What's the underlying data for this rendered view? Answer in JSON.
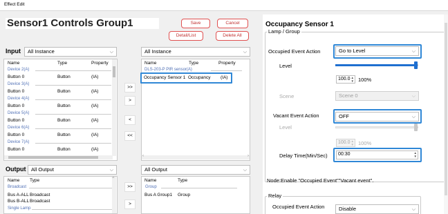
{
  "window": {
    "title": "Effect Edit"
  },
  "header": {
    "name": "Sensor1 Controls Group1",
    "save_label": "Save",
    "cancel_label": "Cancel",
    "detail_label": "Detail/List",
    "delete_all_label": "Delete All"
  },
  "input": {
    "label": "Input",
    "filter_value": "All Instance",
    "columns": [
      "Name",
      "Type",
      "Property"
    ],
    "groups": [
      {
        "group": "Device 2(A)",
        "name": "Button 0",
        "type": "Button",
        "property": "(IA)"
      },
      {
        "group": "Device 3(A)",
        "name": "Button 0",
        "type": "Button",
        "property": "(IA)"
      },
      {
        "group": "Device 4(A)",
        "name": "Button 0",
        "type": "Button",
        "property": "(IA)"
      },
      {
        "group": "Device 5(A)",
        "name": "Button 0",
        "type": "Button",
        "property": "(IA)"
      },
      {
        "group": "Device 6(A)",
        "name": "Button 0",
        "type": "Button",
        "property": "(IA)"
      },
      {
        "group": "Device 7(A)",
        "name": "Button 0",
        "type": "Button",
        "property": "(IA)"
      }
    ],
    "selected": {
      "filter_value": "All Instance",
      "columns": [
        "Name",
        "Type",
        "Property"
      ],
      "group": "DLS-203-P PIR sensor(A)",
      "name": "Occupancy Sensor 1",
      "type": "Occupancy",
      "property": "(IA)"
    }
  },
  "output": {
    "label": "Output",
    "filter_value": "All Output",
    "columns": [
      "Name",
      "Type"
    ],
    "groups": [
      {
        "group": "Broadcast",
        "rows": [
          {
            "name": "Bus A-ALL",
            "type": "Broadcast"
          },
          {
            "name": "Bus B-ALL",
            "type": "Broadcast"
          }
        ]
      },
      {
        "group": "Single Lamp",
        "rows": []
      }
    ],
    "selected": {
      "filter_value": "All Output",
      "columns": [
        "Name",
        "Type"
      ],
      "group": "Group",
      "name": "Bus A Group1",
      "type": "Group"
    }
  },
  "move_buttons": {
    "add_all": ">>",
    "add": ">",
    "remove": "<",
    "remove_all": "<<",
    "out_add_all": ">>",
    "out_add": ">"
  },
  "panel": {
    "title": "Occupancy Sensor 1",
    "lamp_group_legend": "Lamp / Group",
    "occupied_action_label": "Occupied Event Action",
    "occupied_action_value": "Go to Level",
    "level_label": "Level",
    "level_value": "100.0",
    "level_percent": "100%",
    "level_fraction": 1.0,
    "scene_label": "Scene",
    "scene_value": "Scene 0",
    "vacant_action_label": "Vacant Event Action",
    "vacant_action_value": "OFF",
    "vacant_level_label": "Level",
    "vacant_level_value": "100.0",
    "vacant_level_percent": "100%",
    "vacant_level_fraction": 1.0,
    "delay_label": "Delay Time(Min/Sec)",
    "delay_value": "00:30",
    "note": "Node:Enable \"Occupied Event\"\"Vacant event\".",
    "relay_legend": "Relay",
    "relay_action_label": "Occupied Event Action",
    "relay_action_value": "Disable"
  },
  "colors": {
    "accent": "#2f87d6",
    "danger": "#e05050",
    "slider": "#1f6fd0"
  }
}
